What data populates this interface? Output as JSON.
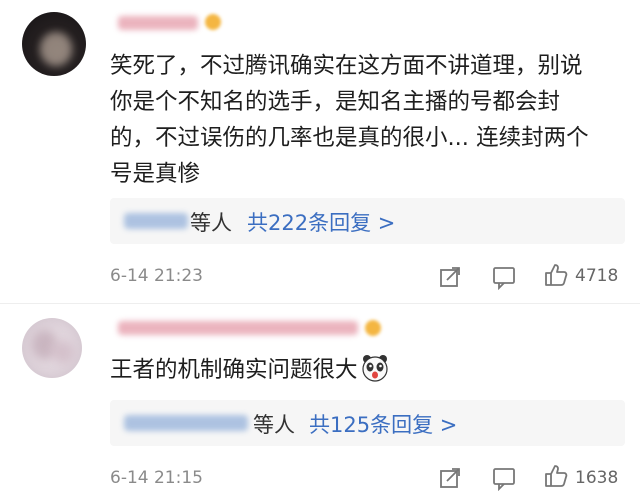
{
  "comments": [
    {
      "text_lines": [
        "笑死了，不过腾讯确实在这方面不讲道理，别说",
        "你是个不知名的选手，是知名主播的号都会封",
        "的，不过误伤的几率也是真的很小... 连续封两个",
        "号是真惨"
      ],
      "reply_others": "等人",
      "reply_link": "共222条回复 >",
      "time": "6-14 21:23",
      "likes": "4718"
    },
    {
      "text": "王者的机制确实问题很大",
      "emoji_icon": "panda-face-icon",
      "reply_others": "等人",
      "reply_link": "共125条回复 >",
      "time": "6-14 21:15",
      "likes": "1638"
    }
  ],
  "colors": {
    "link": "#3b6ec1",
    "name_blur": "#e59aa8",
    "meta": "#8a8a8a"
  }
}
